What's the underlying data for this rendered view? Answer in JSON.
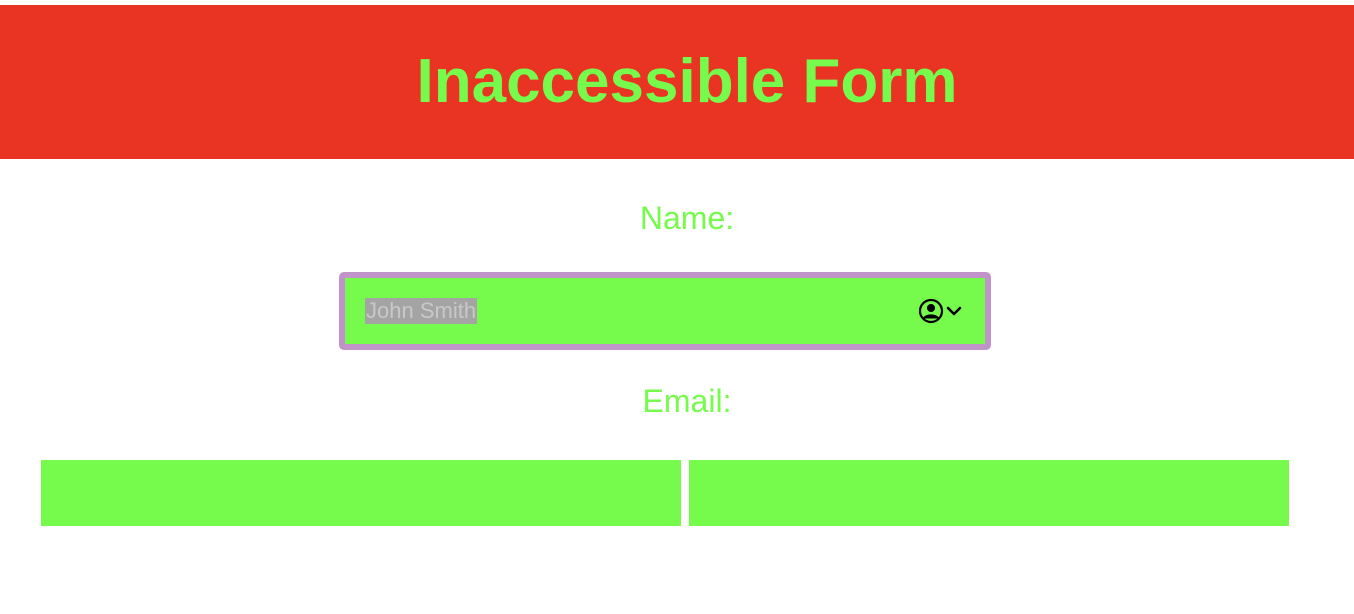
{
  "header": {
    "title": "Inaccessible Form"
  },
  "form": {
    "name_label": "Name:",
    "name_value": "John Smith",
    "autofill_icon": "contact-autofill-icon",
    "email_label": "Email:",
    "email_inputs": [
      {
        "value": ""
      },
      {
        "value": ""
      }
    ]
  },
  "colors": {
    "header_bg": "#e93323",
    "accent_green": "#76fb4d",
    "focus_border": "#c093c9",
    "selection_bg": "#a4a4a4"
  }
}
